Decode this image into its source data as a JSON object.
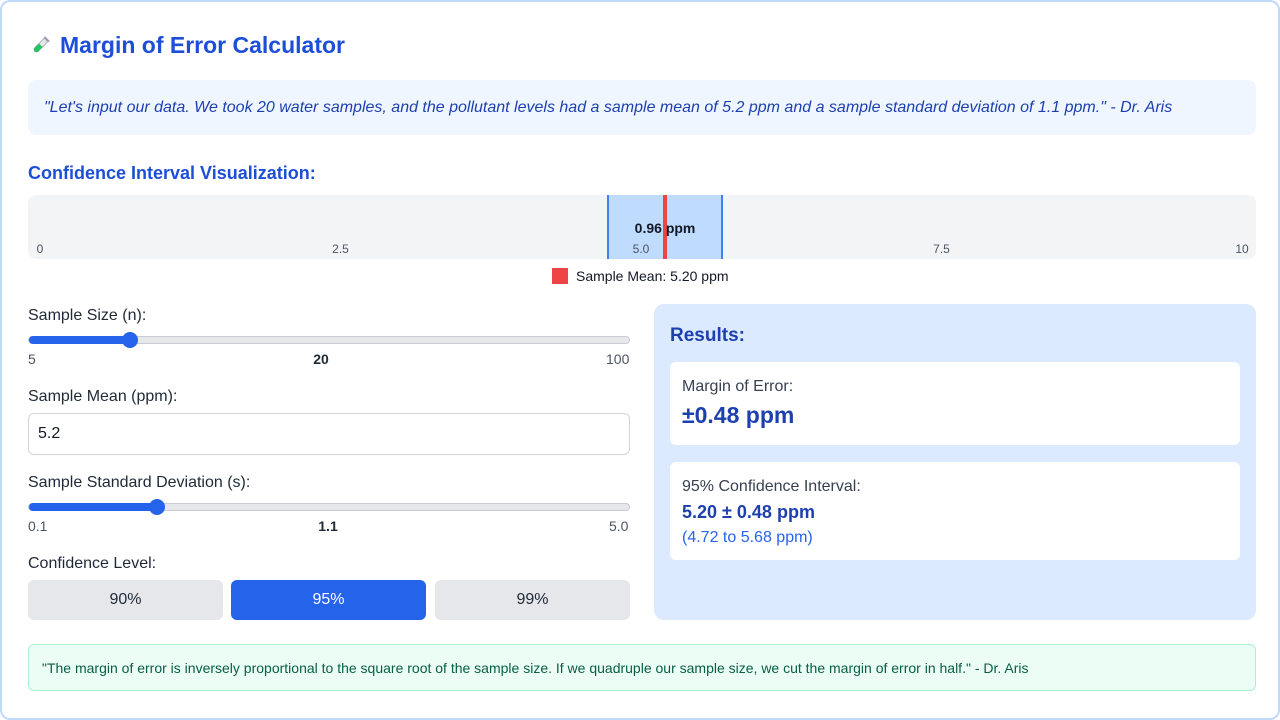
{
  "header": {
    "icon": "test-tube-icon",
    "title": "Margin of Error Calculator"
  },
  "intro_quote": "\"Let's input our data. We took 20 water samples, and the pollutant levels had a sample mean of 5.2 ppm and a sample standard deviation of 1.1 ppm.\" - Dr. Aris",
  "visualization": {
    "heading": "Confidence Interval Visualization:",
    "axis_min": 0,
    "axis_max": 10,
    "ticks": [
      "0",
      "2.5",
      "5.0",
      "7.5",
      "10"
    ],
    "ci_lower": 4.72,
    "ci_upper": 5.68,
    "mean": 5.2,
    "band_label": "0.96 ppm",
    "legend": "Sample Mean: 5.20 ppm",
    "colors": {
      "band": "#bfdbfe",
      "mean": "#ef4444"
    }
  },
  "inputs": {
    "sample_size": {
      "label": "Sample Size (n):",
      "min": "5",
      "max": "100",
      "value": "20"
    },
    "sample_mean": {
      "label": "Sample Mean (ppm):",
      "value": "5.2"
    },
    "sample_sd": {
      "label": "Sample Standard Deviation (s):",
      "min": "0.1",
      "max": "5.0",
      "value": "1.1"
    },
    "confidence": {
      "label": "Confidence Level:",
      "options": [
        "90%",
        "95%",
        "99%"
      ],
      "selected": "95%"
    }
  },
  "results": {
    "title": "Results:",
    "moe_label": "Margin of Error:",
    "moe_value": "±0.48 ppm",
    "ci_label": "95% Confidence Interval:",
    "ci_value": "5.20 ± 0.48 ppm",
    "ci_range": "(4.72 to 5.68 ppm)"
  },
  "footer_quote": "\"The margin of error is inversely proportional to the square root of the sample size. If we quadruple our sample size, we cut the margin of error in half.\" - Dr. Aris",
  "theme": {
    "primary": "#2563eb",
    "heading": "#1d4ed8",
    "results_bg": "#dbeafe",
    "footer_bg": "#ecfdf5"
  }
}
